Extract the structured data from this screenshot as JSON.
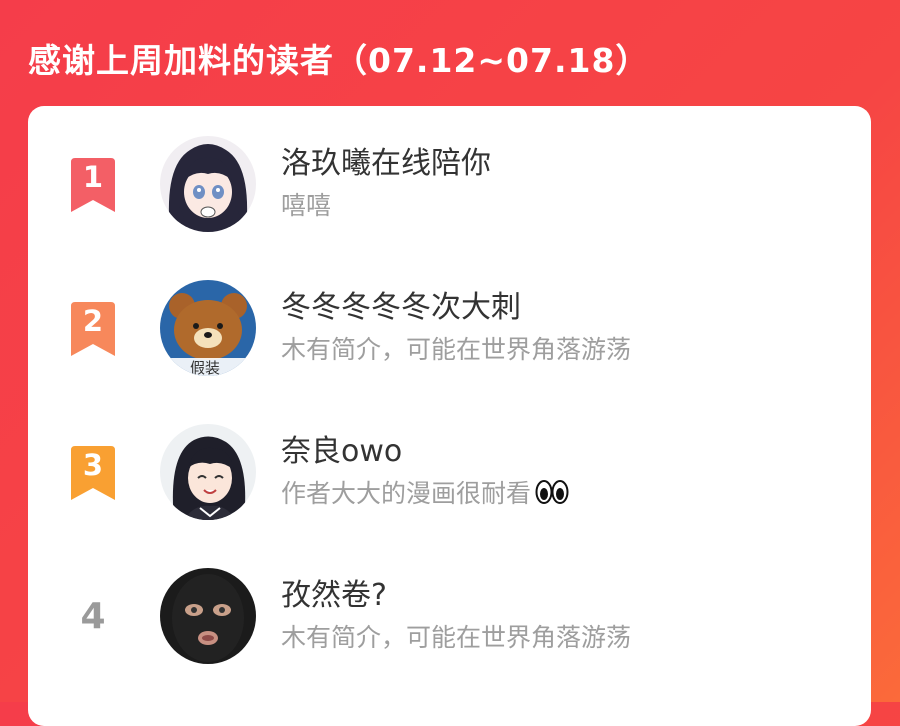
{
  "header": {
    "title": "感谢上周加料的读者（07.12~07.18）"
  },
  "colors": {
    "background": "#f64544",
    "rank1": "#f35f66",
    "rank2": "#f7885b",
    "rank3": "#f9a032",
    "rank_plain": "#9a9a9a"
  },
  "readers": [
    {
      "rank": "1",
      "name": "洛玖曦在线陪你",
      "bio": "嘻嘻",
      "avatar_icon": "anime-girl-avatar"
    },
    {
      "rank": "2",
      "name": "冬冬冬冬冬次大刺",
      "bio": "木有简介，可能在世界角落游荡",
      "avatar_icon": "bear-avatar",
      "avatar_text": "假装"
    },
    {
      "rank": "3",
      "name": "奈良owo",
      "bio": "作者大大的漫画很耐看",
      "bio_emoji": "eyes-emoji",
      "avatar_icon": "anime-girl-smiling-avatar"
    },
    {
      "rank": "4",
      "name": "孜然卷?",
      "bio": "木有简介，可能在世界角落游荡",
      "avatar_icon": "balaclava-avatar"
    }
  ]
}
